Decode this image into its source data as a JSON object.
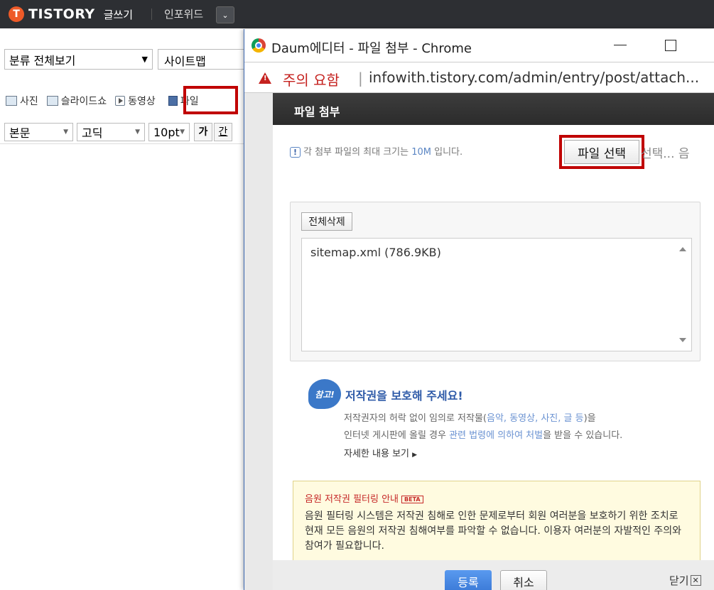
{
  "editor": {
    "logo_mark": "T",
    "logo_text": "TISTORY",
    "logo_sub": "글쓰기",
    "user_name": "인포위드",
    "category": "분류 전체보기",
    "title_value": "사이트맵",
    "toolbar": {
      "photo": "사진",
      "slideshow": "슬라이드쇼",
      "video": "동영상",
      "file": "파일"
    },
    "format": {
      "paragraph": "본문",
      "font": "고딕",
      "size": "10pt",
      "bold": "가",
      "underline": "간"
    }
  },
  "popup": {
    "window_title": "Daum에디터 - 파일 첨부 - Chrome",
    "security_warning": "주의 요함",
    "url": "infowith.tistory.com/admin/entry/post/attach...",
    "header": "파일 첨부",
    "notice_before": "각 첨부 파일의 최대 크기는 ",
    "notice_size": "10M",
    "notice_after": " 입니다.",
    "select_file_label": "파일 선택",
    "no_file_text": "선택... 음",
    "delete_all_label": "전체삭제",
    "files": [
      "sitemap.xml (786.9KB)"
    ],
    "copyright": {
      "badge": "참고!",
      "title": "저작권을 보호해 주세요!",
      "line1_a": "저작권자의 허락 없이 임의로 저작물(",
      "line1_hl": "음악, 동영상, 사진, 글 등",
      "line1_b": ")을",
      "line2_a": "인터넷 게시판에 올릴 경우 ",
      "line2_hl": "관련 법령에 의하여 처벌",
      "line2_b": "을 받을 수 있습니다.",
      "more": "자세한 내용 보기"
    },
    "music": {
      "title": "음원 저작권 필터링 안내",
      "beta": "BETA",
      "desc": "음원 필터링 시스템은 저작권 침해로 인한 문제로부터 회원 여러분을 보호하기 위한 조치로 현재 모든 음원의 저작권 침해여부를 파악할 수 없습니다. 이용자 여러분의 자발적인 주의와 참여가 필요합니다."
    },
    "register_label": "등록",
    "cancel_label": "취소",
    "close_label": "닫기"
  },
  "colors": {
    "highlight_box": "#c00000",
    "primary_button": "#3a78d6",
    "warning": "#c5221f"
  }
}
